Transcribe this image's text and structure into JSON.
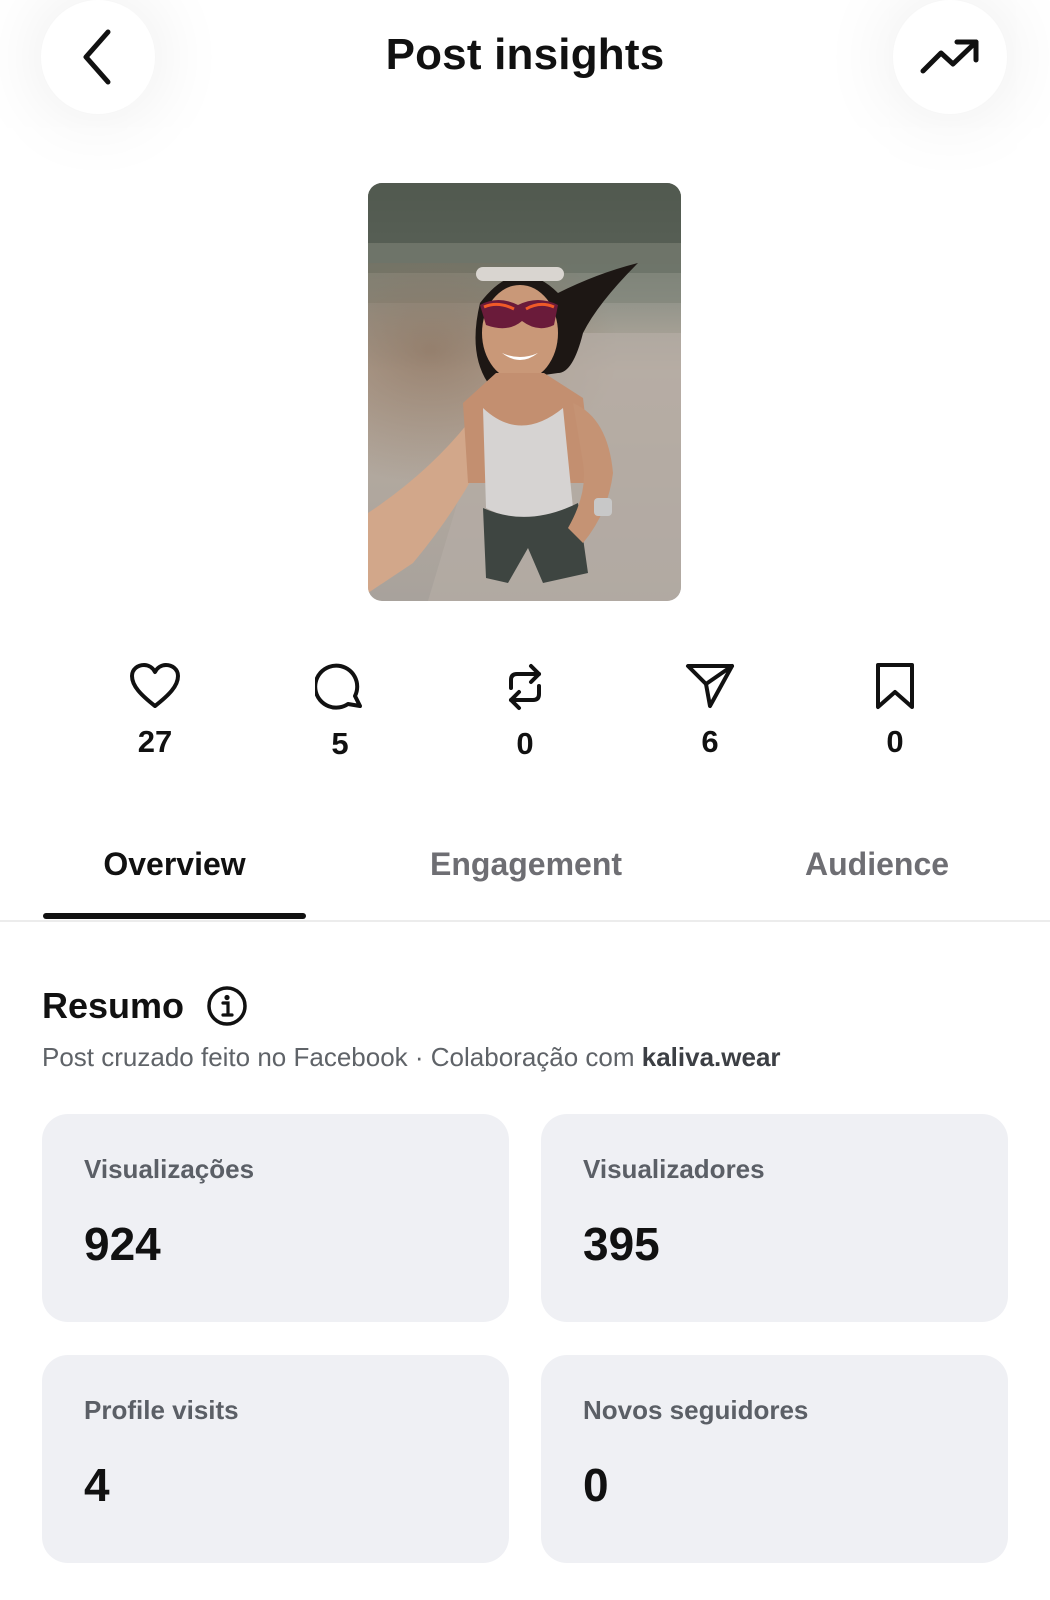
{
  "header": {
    "title": "Post insights",
    "back_icon": "chevron-left-icon",
    "trend_icon": "trending-up-icon"
  },
  "post": {
    "thumbnail": "selfie-photo-runner"
  },
  "stats": [
    {
      "icon": "heart-icon",
      "value": "27"
    },
    {
      "icon": "comment-icon",
      "value": "5"
    },
    {
      "icon": "repost-icon",
      "value": "0"
    },
    {
      "icon": "share-icon",
      "value": "6"
    },
    {
      "icon": "bookmark-icon",
      "value": "0"
    }
  ],
  "tabs": [
    {
      "label": "Overview",
      "active": true
    },
    {
      "label": "Engagement",
      "active": false
    },
    {
      "label": "Audience",
      "active": false
    }
  ],
  "summary": {
    "title": "Resumo",
    "info_icon": "info-icon",
    "subtitle_prefix": "Post cruzado feito no Facebook · Colaboração com ",
    "collaborator": "kaliva.wear"
  },
  "cards": [
    {
      "label": "Visualizações",
      "value": "924"
    },
    {
      "label": "Visualizadores",
      "value": "395"
    },
    {
      "label": "Profile visits",
      "value": "4"
    },
    {
      "label": "Novos seguidores",
      "value": "0"
    }
  ],
  "colors": {
    "text": "#111111",
    "muted": "#6e6e73",
    "card_bg": "#eff0f4",
    "divider": "#ececec"
  }
}
